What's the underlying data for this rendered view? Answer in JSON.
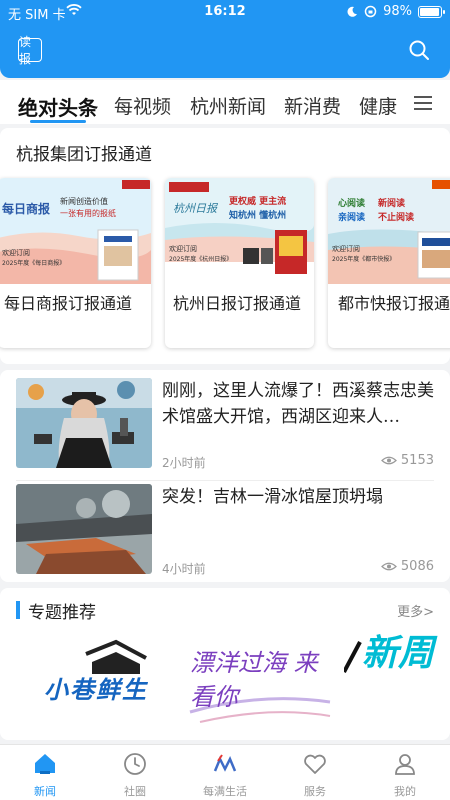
{
  "status_bar": {
    "carrier": "无 SIM 卡",
    "time": "16:12",
    "battery": "98%",
    "battery_level": 0.98
  },
  "header": {
    "read_label": "读报",
    "search_icon": "search-icon"
  },
  "tabs": [
    {
      "label": "绝对头条",
      "active": true
    },
    {
      "label": "每视频",
      "active": false
    },
    {
      "label": "杭州新闻",
      "active": false
    },
    {
      "label": "新消费",
      "active": false
    },
    {
      "label": "健康",
      "active": false
    }
  ],
  "subscription": {
    "title": "杭报集团订报通道",
    "channels": [
      {
        "label": "每日商报订报通道",
        "poster_text": [
          "每日商报",
          "新闻创造价值",
          "一张有用的报纸",
          "欢迎订阅",
          "2025年度《每日商报》"
        ]
      },
      {
        "label": "杭州日报订报通道",
        "poster_text": [
          "杭州日报",
          "更权威 更主流",
          "知杭州 懂杭州",
          "欢迎订阅",
          "2025年度《杭州日报》"
        ]
      },
      {
        "label": "都市快报订报通道",
        "poster_text": [
          "心阅读",
          "新阅读",
          "亲阅读",
          "不止阅读",
          "欢迎订阅",
          "2025年度《都市快报》"
        ]
      }
    ]
  },
  "news": [
    {
      "headline": "刚刚，这里人流爆了！西溪蔡志忠美术馆盛大开馆，西湖区迎来人…",
      "time": "2小时前",
      "views": "5153"
    },
    {
      "headline": "突发！吉林一滑冰馆屋顶坍塌",
      "time": "4小时前",
      "views": "5086"
    }
  ],
  "topics": {
    "title": "专题推荐",
    "more": "更多>",
    "items": [
      {
        "text": "小巷鲜生",
        "color": "#1565c0"
      },
      {
        "text": "漂洋过海 来看你",
        "color": "#7b3fbf"
      },
      {
        "text": "新周 创造者",
        "color": "#00bcd4"
      }
    ]
  },
  "bottom_nav": [
    {
      "label": "新闻",
      "icon": "home-icon",
      "active": true
    },
    {
      "label": "社圈",
      "icon": "clock-icon",
      "active": false
    },
    {
      "label": "每满生活",
      "icon": "logo-icon",
      "active": false
    },
    {
      "label": "服务",
      "icon": "heart-icon",
      "active": false
    },
    {
      "label": "我的",
      "icon": "person-icon",
      "active": false
    }
  ],
  "colors": {
    "accent": "#2196f3",
    "header_bg": "#2196f3",
    "muted_text": "#999999"
  }
}
